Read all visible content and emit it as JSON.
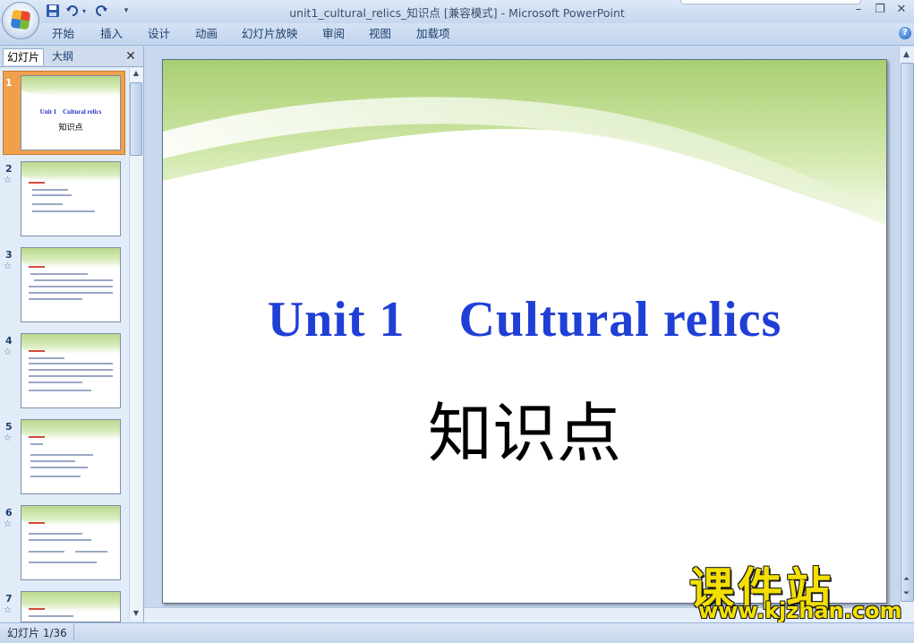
{
  "window": {
    "title": "unit1_cultural_relics_知识点 [兼容模式] - Microsoft PowerPoint",
    "minimize": "–",
    "restore": "❐",
    "close": "✕"
  },
  "qat": {
    "save_icon": "save-icon",
    "undo_icon": "undo-icon",
    "redo_icon": "redo-icon"
  },
  "ribbon": {
    "tabs": [
      "开始",
      "插入",
      "设计",
      "动画",
      "幻灯片放映",
      "审阅",
      "视图",
      "加载项"
    ],
    "help": "?"
  },
  "slide_pane": {
    "tabs": [
      "幻灯片",
      "大纲"
    ],
    "close": "✕",
    "thumbs": [
      {
        "num": "1",
        "title": "Unit 1    Cultural relics",
        "sub": "知识点"
      },
      {
        "num": "2",
        "star": "☆"
      },
      {
        "num": "3",
        "star": "☆"
      },
      {
        "num": "4",
        "star": "☆"
      },
      {
        "num": "5",
        "star": "☆"
      },
      {
        "num": "6",
        "star": "☆"
      },
      {
        "num": "7",
        "star": "☆"
      }
    ]
  },
  "slide": {
    "title": "Unit 1    Cultural relics",
    "subtitle": "知识点"
  },
  "watermark": {
    "cn": "课件站",
    "url": "www.kjzhan.com"
  },
  "status": {
    "slide_counter": "幻灯片 1/36"
  },
  "colors": {
    "slide_title": "#1f3fd6",
    "watermark": "#f3e000",
    "wave_green": "#b9d98c"
  }
}
